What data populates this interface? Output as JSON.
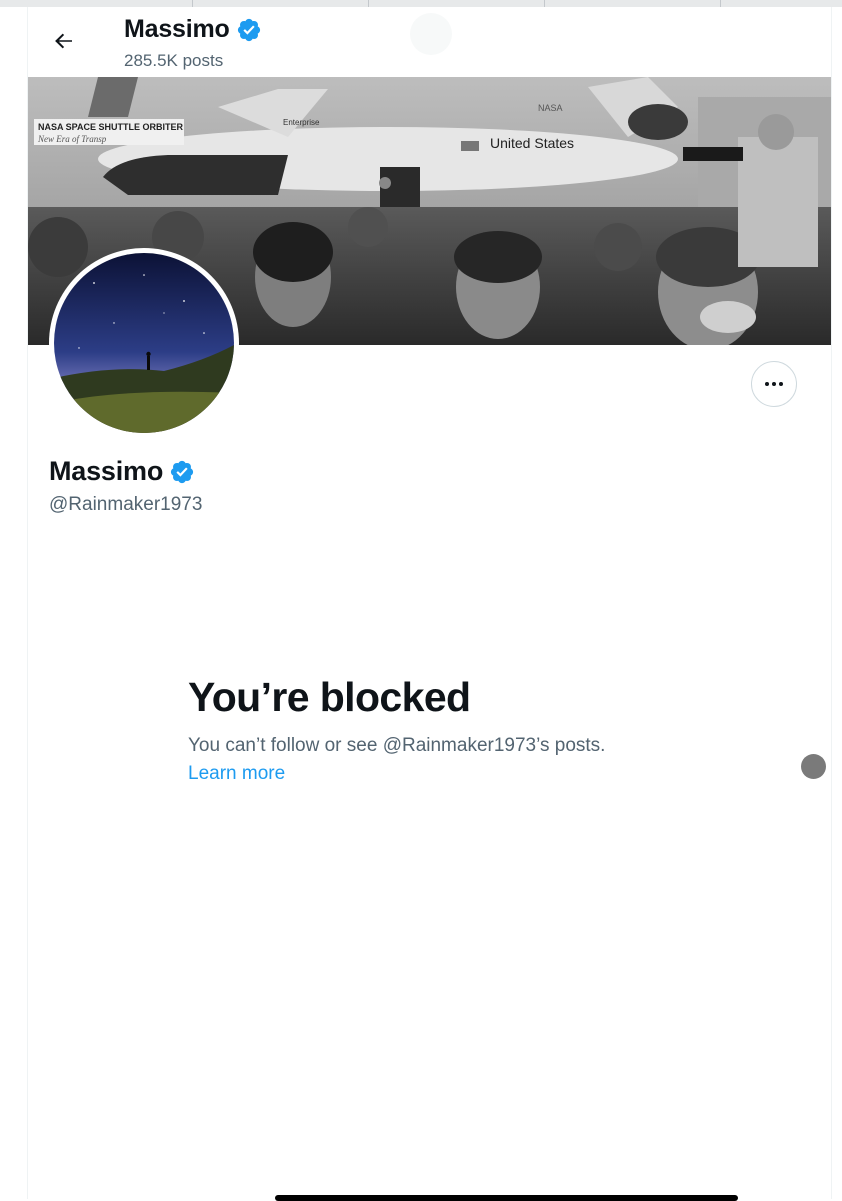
{
  "header": {
    "name": "Massimo",
    "posts_count": "285.5K posts"
  },
  "profile": {
    "name": "Massimo",
    "handle": "@Rainmaker1973",
    "verified": true
  },
  "blocked": {
    "title": "You’re blocked",
    "message": "You can’t follow or see @Rainmaker1973’s posts.",
    "learn_more": "Learn more"
  },
  "banner": {
    "sign_text": "NASA SPACE SHUTTLE ORBITER",
    "sign_subtext": "New Era of Transp",
    "orbiter_name": "Enterprise",
    "nasa_logo": "NASA",
    "united_states": "United States"
  },
  "icons": {
    "back": "arrow-left-icon",
    "verified": "verified-badge-icon",
    "more": "more-horizontal-icon"
  },
  "colors": {
    "accent": "#1d9bf0",
    "text_primary": "#0f1419",
    "text_secondary": "#536471",
    "verified": "#1d9bf0"
  }
}
